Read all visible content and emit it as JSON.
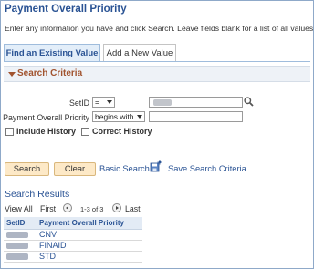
{
  "page": {
    "title": "Payment Overall Priority",
    "instructions": "Enter any information you have and click Search. Leave fields blank for a list of all values"
  },
  "tabs": [
    "Find an Existing Value",
    "Add a New Value"
  ],
  "search_criteria": {
    "title": "Search Criteria",
    "setid": {
      "label": "SetID",
      "operator": "=",
      "value": ""
    },
    "priority": {
      "label": "Payment Overall Priority",
      "operator": "begins with",
      "value": ""
    },
    "include_history": {
      "label": "Include History",
      "checked": false
    },
    "correct_history": {
      "label": "Correct History",
      "checked": false
    }
  },
  "actions": {
    "search": "Search",
    "clear": "Clear",
    "basic_search": "Basic Search",
    "save_search": "Save Search Criteria"
  },
  "results": {
    "title": "Search Results",
    "view_all": "View All",
    "first": "First",
    "range": "1-3 of 3",
    "last": "Last",
    "columns": [
      "SetID",
      "Payment Overall Priority"
    ],
    "rows": [
      {
        "setid": "",
        "priority": "CNV"
      },
      {
        "setid": "",
        "priority": "FINAID"
      },
      {
        "setid": "",
        "priority": "STD"
      }
    ]
  },
  "colors": {
    "title_blue": "#2a5394",
    "section_header_brown": "#a1532e",
    "button_fill": "#fde9c7"
  },
  "icons": [
    "lookup-icon",
    "save-search-icon",
    "previous-icon",
    "next-icon",
    "collapse-triangle-icon"
  ]
}
